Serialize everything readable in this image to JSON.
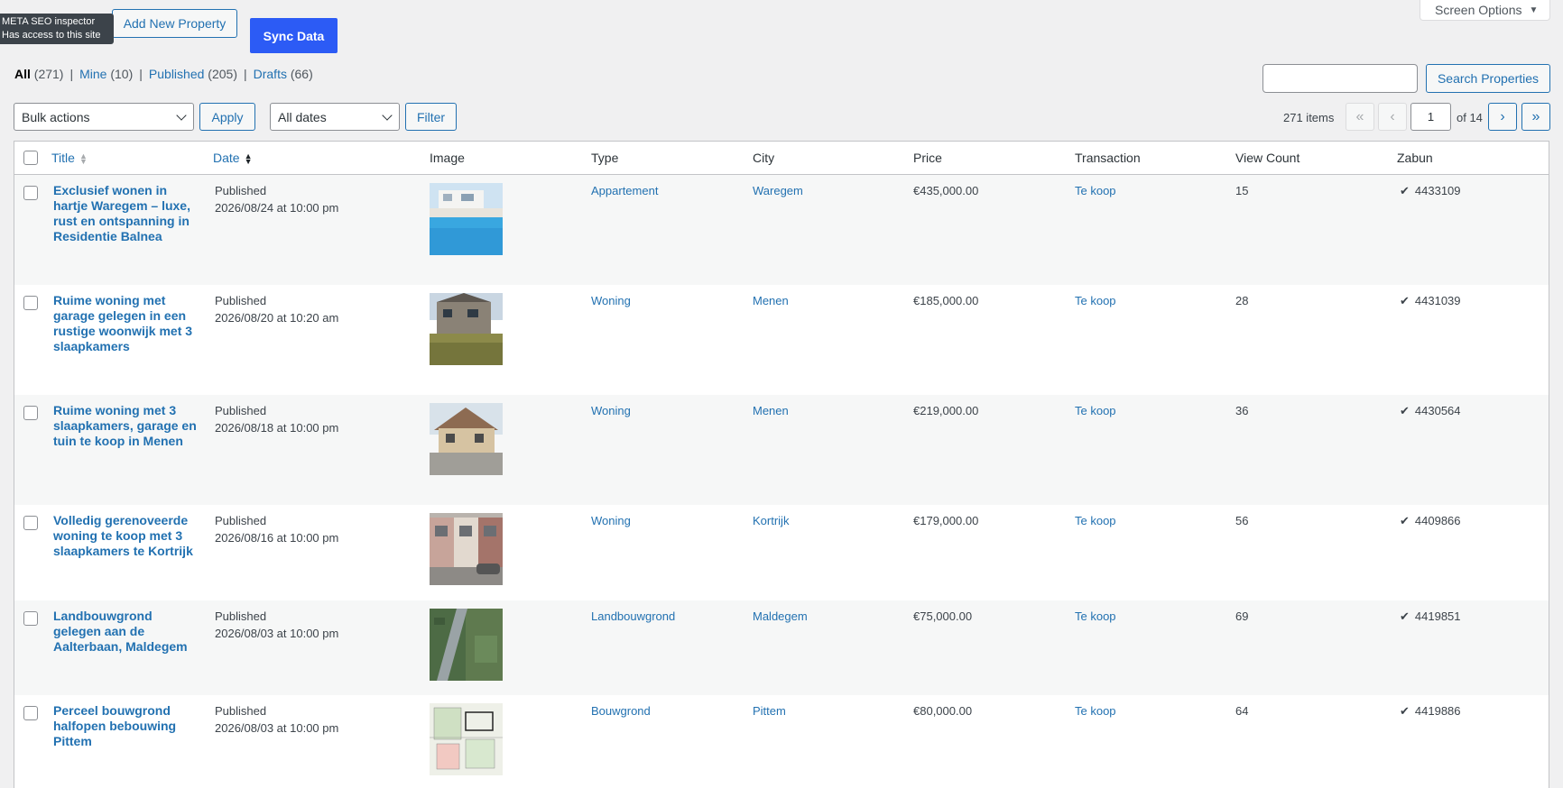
{
  "tooltip": {
    "line1": "META SEO inspector",
    "line2": "Has access to this site"
  },
  "header": {
    "add_new_label": "Add New Property",
    "sync_label": "Sync Data",
    "screen_options_label": "Screen Options",
    "screen_options_arrow": "▼"
  },
  "views": [
    {
      "label": "All",
      "count": "(271)",
      "current": true
    },
    {
      "label": "Mine",
      "count": "(10)"
    },
    {
      "label": "Published",
      "count": "(205)"
    },
    {
      "label": "Drafts",
      "count": "(66)"
    }
  ],
  "views_separator": "|",
  "search": {
    "value": "",
    "button_label": "Search Properties"
  },
  "toolbar": {
    "bulk_actions": "Bulk actions",
    "apply_label": "Apply",
    "dates": "All dates",
    "filter_label": "Filter"
  },
  "pagination": {
    "items": "271 items",
    "first": "«",
    "prev": "‹",
    "current_page": "1",
    "of_total": "of 14",
    "next": "›",
    "last": "»"
  },
  "columns": {
    "title": "Title",
    "date": "Date",
    "image": "Image",
    "type": "Type",
    "city": "City",
    "price": "Price",
    "transaction": "Transaction",
    "view_count": "View Count",
    "zabun": "Zabun"
  },
  "rows": [
    {
      "title": "Exclusief wonen in hartje Waregem – luxe, rust en ontspanning in Residentie Balnea",
      "status": "Published",
      "date": "2026/08/24 at 10:00 pm",
      "image_icon": "pool-photo",
      "type": "Appartement",
      "city": "Waregem",
      "price": "€435,000.00",
      "transaction": "Te koop",
      "views": "15",
      "zabun_mark": "✔",
      "zabun": "4433109"
    },
    {
      "title": "Ruime woning met garage gelegen in een rustige woonwijk met 3 slaapkamers",
      "status": "Published",
      "date": "2026/08/20 at 10:20 am",
      "image_icon": "house-photo",
      "type": "Woning",
      "city": "Menen",
      "price": "€185,000.00",
      "transaction": "Te koop",
      "views": "28",
      "zabun_mark": "✔",
      "zabun": "4431039"
    },
    {
      "title": "Ruime woning met 3 slaapkamers, garage en tuin te koop in Menen",
      "status": "Published",
      "date": "2026/08/18 at 10:00 pm",
      "image_icon": "house-photo",
      "type": "Woning",
      "city": "Menen",
      "price": "€219,000.00",
      "transaction": "Te koop",
      "views": "36",
      "zabun_mark": "✔",
      "zabun": "4430564"
    },
    {
      "title": "Volledig gerenoveerde woning te koop met 3 slaapkamers te Kortrijk",
      "status": "Published",
      "date": "2026/08/16 at 10:00 pm",
      "image_icon": "street-photo",
      "type": "Woning",
      "city": "Kortrijk",
      "price": "€179,000.00",
      "transaction": "Te koop",
      "views": "56",
      "zabun_mark": "✔",
      "zabun": "4409866"
    },
    {
      "title": "Landbouwgrond gelegen aan de Aalterbaan, Maldegem",
      "status": "Published",
      "date": "2026/08/03 at 10:00 pm",
      "image_icon": "aerial-photo",
      "type": "Landbouwgrond",
      "city": "Maldegem",
      "price": "€75,000.00",
      "transaction": "Te koop",
      "views": "69",
      "zabun_mark": "✔",
      "zabun": "4419851"
    },
    {
      "title": "Perceel bouwgrond halfopen bebouwing Pittem",
      "status": "Published",
      "date": "2026/08/03 at 10:00 pm",
      "image_icon": "plan-map",
      "type": "Bouwgrond",
      "city": "Pittem",
      "price": "€80,000.00",
      "transaction": "Te koop",
      "views": "64",
      "zabun_mark": "✔",
      "zabun": "4419886"
    }
  ]
}
